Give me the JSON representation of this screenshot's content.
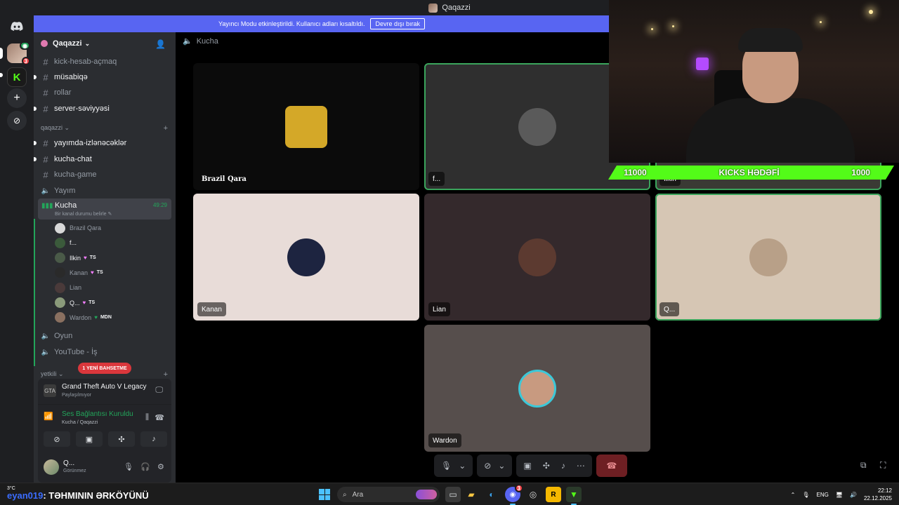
{
  "window": {
    "title": "Qaqazzi"
  },
  "banner": {
    "text": "Yayıncı Modu etkinleştirildi. Kullanıcı adları kısaltıldı.",
    "button": "Devre dışı bırak"
  },
  "rail": {
    "badge_count": "3"
  },
  "server": {
    "name": "Qaqazzi"
  },
  "channels_top": [
    {
      "name": "kick-hesab-açmaq",
      "unread": false
    },
    {
      "name": "müsabiqə",
      "unread": true
    },
    {
      "name": "rollar",
      "unread": false
    },
    {
      "name": "server-səviyyəsi",
      "unread": true
    }
  ],
  "category_qaqazzi": "qaqazzi",
  "channels_mid": [
    {
      "name": "yayımda-izlənəcəklər",
      "unread": true,
      "type": "text"
    },
    {
      "name": "kucha-chat",
      "unread": true,
      "type": "text"
    },
    {
      "name": "kucha-game",
      "unread": false,
      "type": "text"
    },
    {
      "name": "Yayım",
      "unread": false,
      "type": "voice"
    }
  ],
  "active_voice": {
    "name": "Kucha",
    "time": "49:29",
    "status_placeholder": "Bir kanal durumu belirle"
  },
  "voice_members": [
    {
      "name": "Brazil Qara",
      "tag": "",
      "heart": false,
      "bright": false
    },
    {
      "name": "f...",
      "tag": "",
      "heart": false,
      "bright": true
    },
    {
      "name": "Ilkin",
      "tag": "TS",
      "heart": true,
      "bright": true
    },
    {
      "name": "Kanan",
      "tag": "TS",
      "heart": true,
      "bright": false
    },
    {
      "name": "Lian",
      "tag": "",
      "heart": false,
      "bright": false
    },
    {
      "name": "Q...",
      "tag": "TS",
      "heart": true,
      "bright": true
    },
    {
      "name": "Wardon",
      "tag": "MDN",
      "heart": false,
      "bright": false
    }
  ],
  "channels_bottom": [
    {
      "name": "Oyun"
    },
    {
      "name": "YouTube - İş"
    }
  ],
  "category_yetkili": "Yetkili",
  "new_mention": "1 YENİ BAHSETME",
  "activity": {
    "game": "Grand Theft Auto V Legacy",
    "sub": "Paylaşılmıyor",
    "icon_label": "GTA"
  },
  "voice_panel": {
    "title": "Ses Bağlantısı Kuruldu",
    "sub": "Kucha / Qaqazzi"
  },
  "user": {
    "name": "Q...",
    "status": "Görünmez"
  },
  "main_header": {
    "channel": "Kucha"
  },
  "tiles": [
    {
      "name": "Brazil Qara",
      "bg": "#0b0b0b",
      "avatar": "#d4a828",
      "speaking": false
    },
    {
      "name": "f...",
      "bg": "#2f2f2f",
      "avatar": "#5a5a5a",
      "speaking": true
    },
    {
      "name": "Ilkin",
      "bg": "#3a3a34",
      "avatar": "#6a6a6a",
      "speaking": true
    },
    {
      "name": "Kanan",
      "bg": "#e8dcd8",
      "avatar": "#1d2440",
      "speaking": false
    },
    {
      "name": "Lian",
      "bg": "#34292c",
      "avatar": "#5c3a30",
      "speaking": false
    },
    {
      "name": "Q...",
      "bg": "#d6c6b4",
      "avatar": "#b8a088",
      "speaking": true
    },
    {
      "name": "Wardon",
      "bg": "#564e4c",
      "avatar": "#3cc8d8",
      "speaking": false
    }
  ],
  "kicks": {
    "left": "11000",
    "label": "KICKS HƏDƏFİ",
    "right": "1000"
  },
  "taskbar": {
    "weather": "3°C",
    "ticker_user": "eyan019",
    "ticker_text": ": TƏHMININ ƏRKÖYÜNÜ",
    "search": "Ara",
    "discord_badge": "3",
    "lang": "ENG",
    "time": "22:12",
    "date": "22.12.2025"
  },
  "colors": {
    "accent": "#5865f2",
    "online": "#23a55a",
    "kick_green": "#53fc18",
    "danger": "#da373c"
  }
}
